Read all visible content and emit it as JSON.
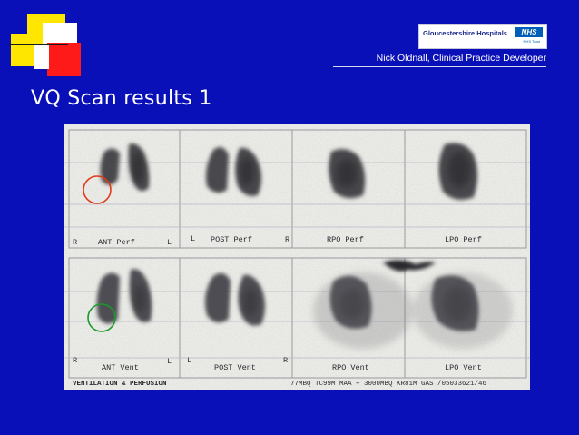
{
  "header": {
    "author": "Nick Oldnall, Clinical Practice Developer",
    "logo": {
      "name": "Gloucestershire Hospitals",
      "badge": "NHS",
      "subtitle": "NHS Trust"
    }
  },
  "slide": {
    "title": "VQ Scan results 1"
  },
  "scan": {
    "perfusion_row": {
      "views": [
        {
          "left_marker": "R",
          "label": "ANT Perf",
          "right_marker": "L"
        },
        {
          "left_marker": "L",
          "label": "POST Perf",
          "right_marker": "R"
        },
        {
          "left_marker": "",
          "label": "RPO Perf",
          "right_marker": ""
        },
        {
          "left_marker": "",
          "label": "LPO Perf",
          "right_marker": ""
        }
      ]
    },
    "ventilation_row": {
      "views": [
        {
          "left_marker": "R",
          "label": "ANT Vent",
          "right_marker": "L"
        },
        {
          "left_marker": "L",
          "label": "POST Vent",
          "right_marker": "R"
        },
        {
          "left_marker": "",
          "label": "RPO Vent",
          "right_marker": ""
        },
        {
          "left_marker": "",
          "label": "LPO Vent",
          "right_marker": ""
        }
      ]
    },
    "footer_left": "VENTILATION & PERFUSION",
    "footer_right": "77MBQ TC99M MAA + 3000MBQ KR81M GAS /05033621/46"
  },
  "annotations": {
    "perfusion_circle_color": "#e03a1a",
    "ventilation_circle_color": "#1a9a2a"
  },
  "colors": {
    "background": "#0a10b8",
    "deco_yellow": "#ffe600",
    "deco_red": "#ff1a1a",
    "deco_white": "#ffffff"
  }
}
